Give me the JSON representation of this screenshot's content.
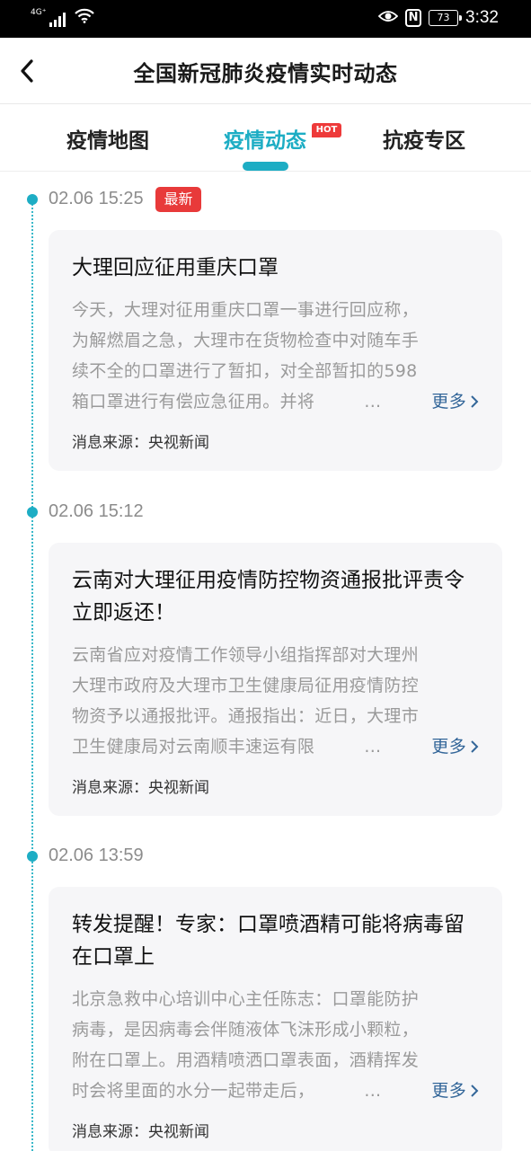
{
  "status_bar": {
    "network": "4G⁺",
    "battery": "73",
    "time": "3:32"
  },
  "header": {
    "title": "全国新冠肺炎疫情实时动态"
  },
  "tabs": [
    {
      "label": "疫情地图"
    },
    {
      "label": "疫情动态",
      "badge": "HOT"
    },
    {
      "label": "抗疫专区"
    }
  ],
  "colors": {
    "accent": "#1dadc4",
    "badge_red": "#e83a3a",
    "link": "#336699"
  },
  "icons": [
    "back-arrow-icon",
    "signal-icon",
    "wifi-icon",
    "eye-icon",
    "nfc-icon",
    "battery-icon",
    "chevron-right-icon"
  ],
  "feed": [
    {
      "time": "02.06 15:25",
      "badge": "最新",
      "title": "大理回应征用重庆口罩",
      "body": [
        "今天，大理对征用重庆口罩一事进行回应称，",
        "为解燃眉之急，大理市在货物检查中对随车手",
        "续不全的口罩进行了暂扣，对全部暂扣的598",
        "箱口罩进行有偿应急征用。并将"
      ],
      "ellipsis": "...",
      "more": "更多",
      "source": "消息来源：央视新闻"
    },
    {
      "time": "02.06 15:12",
      "title": "云南对大理征用疫情防控物资通报批评责令立即返还！",
      "body": [
        "云南省应对疫情工作领导小组指挥部对大理州",
        "大理市政府及大理市卫生健康局征用疫情防控",
        "物资予以通报批评。通报指出：近日，大理市",
        "卫生健康局对云南顺丰速运有限"
      ],
      "ellipsis": "...",
      "more": "更多",
      "source": "消息来源：央视新闻"
    },
    {
      "time": "02.06 13:59",
      "title": "转发提醒！专家：口罩喷酒精可能将病毒留在口罩上",
      "body": [
        "北京急救中心培训中心主任陈志：口罩能防护",
        "病毒，是因病毒会伴随液体飞沫形成小颗粒，",
        "附在口罩上。用酒精喷洒口罩表面，酒精挥发",
        "时会将里面的水分一起带走后，"
      ],
      "ellipsis": "...",
      "more": "更多",
      "source": "消息来源：央视新闻"
    }
  ]
}
